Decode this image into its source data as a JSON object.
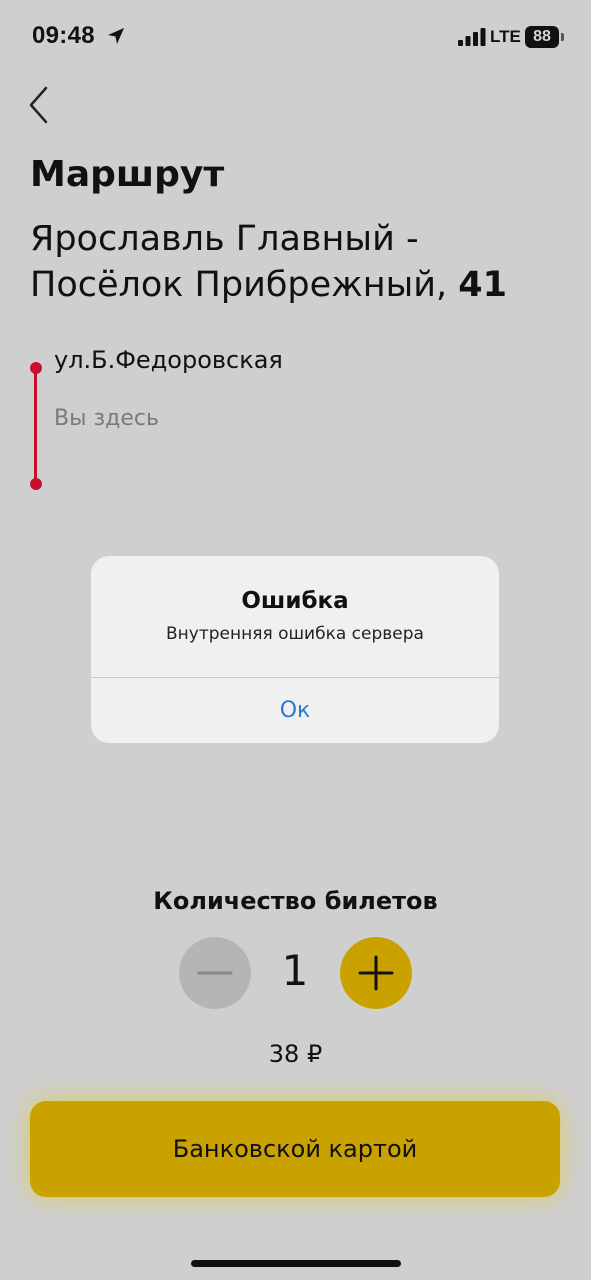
{
  "status_bar": {
    "time": "09:48",
    "network": "LTE",
    "battery": "88",
    "icons": [
      "location-arrow-icon",
      "signal-bars-icon",
      "battery-icon"
    ]
  },
  "header": {
    "back_icon": "chevron-left-icon",
    "title": "Маршрут",
    "route_name": "Ярославль Главный - Посёлок Прибрежный,",
    "route_number": "41"
  },
  "route_timeline": {
    "color": "#c8102e",
    "stop_name": "ул.Б.Федоровская",
    "stop_note": "Вы здесь"
  },
  "alert": {
    "title": "Ошибка",
    "message": "Внутренняя ошибка сервера",
    "ok_label": "Ок",
    "ok_color": "#2a7ad2"
  },
  "tickets": {
    "label": "Количество билетов",
    "count": "1",
    "minus_icon": "minus-icon",
    "plus_icon": "plus-icon",
    "price": "38 ₽"
  },
  "payment": {
    "button_label": "Банковской картой",
    "accent_color": "#c9a200"
  }
}
